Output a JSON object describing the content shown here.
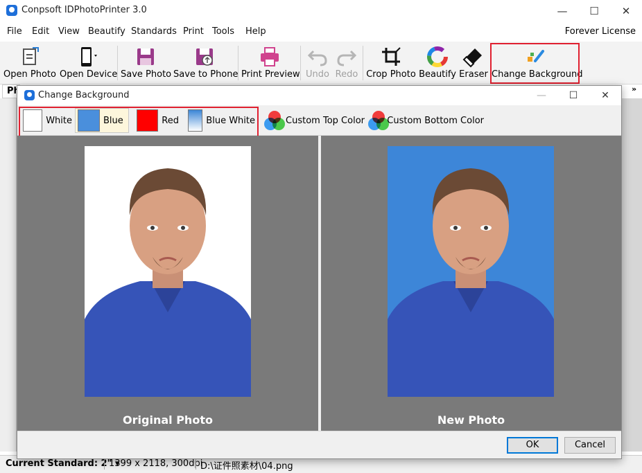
{
  "app": {
    "title": "Conpsoft IDPhotoPrinter 3.0",
    "license": "Forever License",
    "controls": {
      "minimize": "—",
      "maximize": "☐",
      "close": "✕"
    }
  },
  "menu": [
    "File",
    "Edit",
    "View",
    "Beautify",
    "Standards",
    "Print",
    "Tools",
    "Help"
  ],
  "toolbar": {
    "open_photo": "Open Photo",
    "open_device": "Open Device",
    "save_photo": "Save Photo",
    "save_to_phone": "Save to Phone",
    "print_preview": "Print Preview",
    "undo": "Undo",
    "redo": "Redo",
    "crop_photo": "Crop Photo",
    "beautify": "Beautify",
    "eraser": "Eraser",
    "change_background": "Change Background",
    "more": "»"
  },
  "left_tab": "Ph",
  "status": {
    "standard": "Current Standard: 2\" ▾",
    "info": "1399 x 2118, 300dpi",
    "path": "D:\\证件照素材\\04.png"
  },
  "dialog": {
    "title": "Change Background",
    "options": [
      {
        "label": "White",
        "color": "#ffffff"
      },
      {
        "label": "Blue",
        "color": "#4a8fdc"
      },
      {
        "label": "Red",
        "color": "#ff0000"
      },
      {
        "label": "Blue White",
        "color": "#5c9ee0"
      }
    ],
    "selected": "Blue",
    "custom_top": "Custom Top Color",
    "custom_bottom": "Custom Bottom Color",
    "original_caption": "Original Photo",
    "new_caption": "New Photo",
    "ok": "OK",
    "cancel": "Cancel",
    "controls": {
      "minimize": "—",
      "maximize": "☐",
      "close": "✕"
    }
  },
  "colors": {
    "accent": "#e02030",
    "new_photo_bg": "#3d86d8",
    "shirt": "#3654b8",
    "skin": "#d8a082",
    "hair": "#6b4a35"
  }
}
